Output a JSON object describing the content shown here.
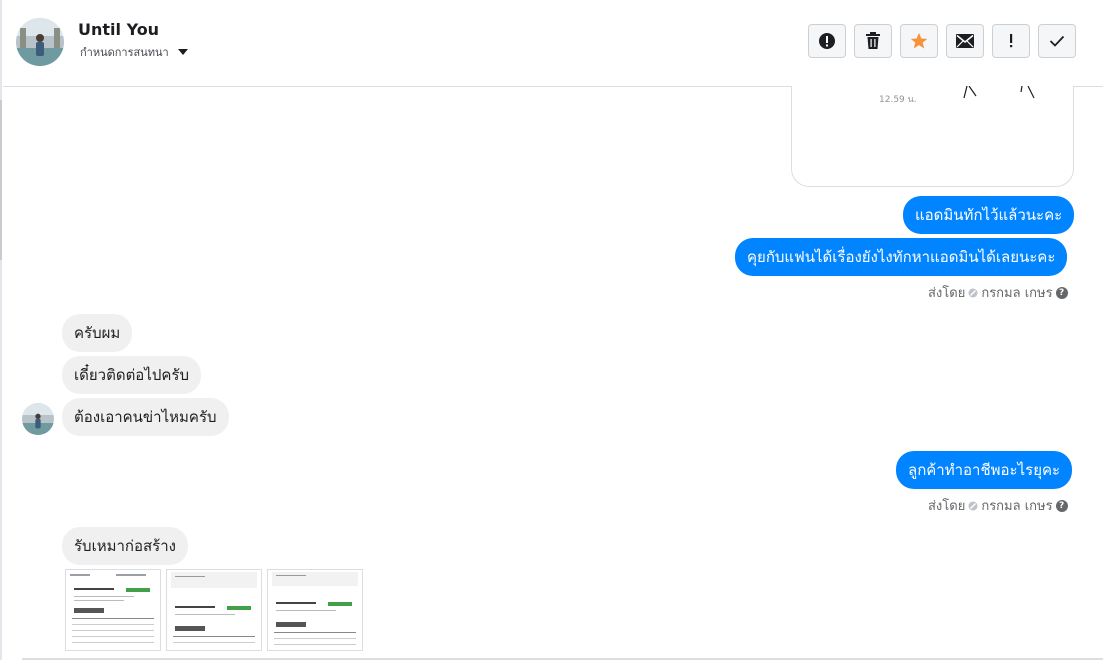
{
  "header": {
    "contact_name": "Until You",
    "conversation_settings": "กำหนดการสนทนา",
    "toolbar": {
      "items": [
        {
          "name": "mark-spam",
          "icon": "exclamation-circle-icon"
        },
        {
          "name": "delete",
          "icon": "trash-icon"
        },
        {
          "name": "star",
          "icon": "star-icon"
        },
        {
          "name": "mark-unread",
          "icon": "envelope-icon"
        },
        {
          "name": "flag",
          "icon": "exclamation-icon"
        },
        {
          "name": "done",
          "icon": "check-icon"
        }
      ]
    }
  },
  "messages": {
    "card_time": "12.59 น.",
    "out_1": "แอดมินทักไว้แล้วนะคะ",
    "out_2": "คุยกับแฟนได้เรื่องยังไงทักหาแอดมินได้เลยนะคะ",
    "sent_by_label_1": "ส่งโดย",
    "sent_by_name_1": "กรกมล เกษร",
    "in_1": "ครับผม",
    "in_2": "เดี๋ยวติดต่อไปครับ",
    "in_3": "ต้องเอาคนข่าไหมครับ",
    "out_3": "ลูกค้าทำอาชีพอะไรยุคะ",
    "sent_by_label_2": "ส่งโดย",
    "sent_by_name_2": "กรกมล เกษร",
    "in_4": "รับเหมาก่อสร้าง"
  },
  "colors": {
    "outgoing_bubble": "#0084ff",
    "incoming_bubble": "#f1f0f0",
    "star_accent": "#f7923a"
  }
}
